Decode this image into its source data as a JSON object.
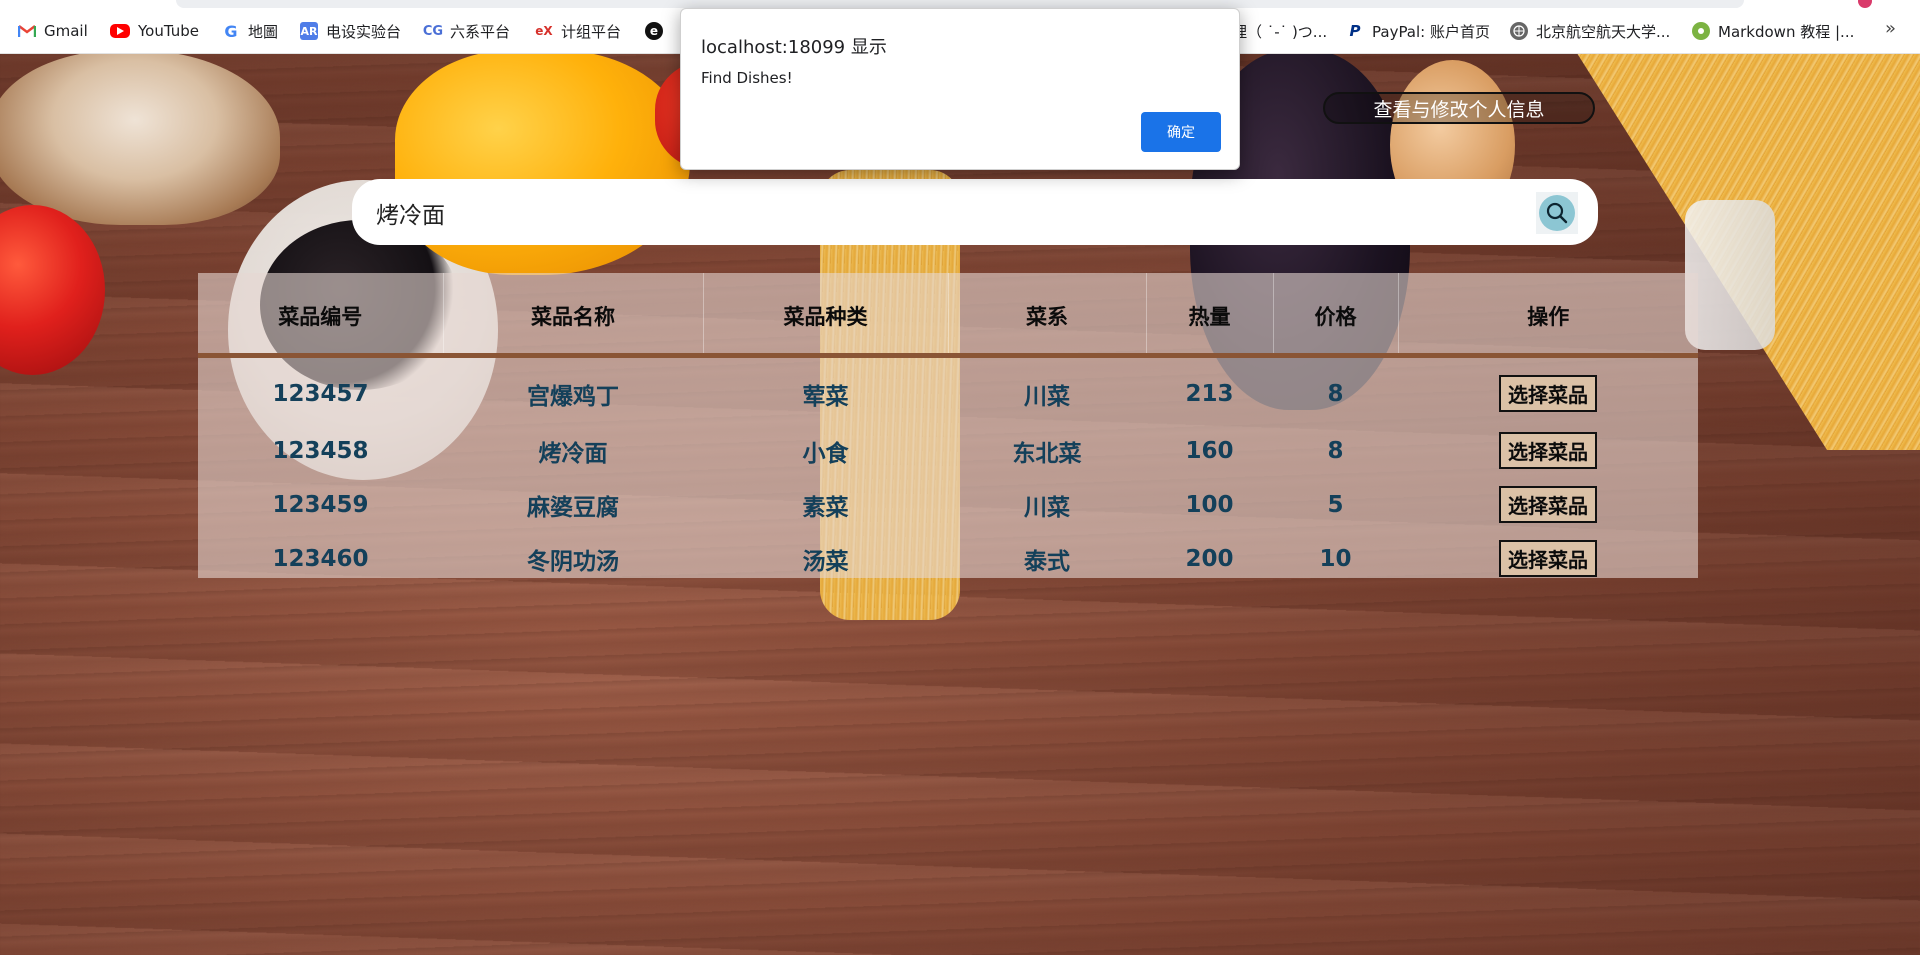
{
  "bookmarks": [
    {
      "label": "Gmail",
      "icon": "gmail-icon",
      "color": "#ea4335"
    },
    {
      "label": "YouTube",
      "icon": "youtube-icon",
      "color": "#ff0000"
    },
    {
      "label": "地圖",
      "icon": "google-icon",
      "color": "#4285f4"
    },
    {
      "label": "电设实验台",
      "icon": "lab-icon",
      "color": "#4f7de8"
    },
    {
      "label": "六系平台",
      "icon": "platform-icon",
      "color": "#4a6fd6"
    },
    {
      "label": "计组平台",
      "icon": "edx-icon",
      "color": "#d6312b"
    },
    {
      "label": "",
      "icon": "circle-e-icon",
      "color": "#111111"
    },
    {
      "label": "理（ ˙-˙ )つ...",
      "icon": "",
      "color": ""
    },
    {
      "label": "PayPal: 账户首页",
      "icon": "paypal-icon",
      "color": "#003087"
    },
    {
      "label": "北京航空航天大学...",
      "icon": "globe-icon",
      "color": "#555555"
    },
    {
      "label": "Markdown 教程 |...",
      "icon": "markdown-icon",
      "color": "#7cb342"
    }
  ],
  "more_bookmarks": "»",
  "alert": {
    "title": "localhost:18099 显示",
    "message": "Find Dishes!",
    "ok_label": "确定"
  },
  "profile_button": "查看与修改个人信息",
  "search": {
    "value": "烤冷面",
    "icon": "search-icon"
  },
  "table": {
    "headers": [
      "菜品编号",
      "菜品名称",
      "菜品种类",
      "菜系",
      "热量",
      "价格",
      "操作"
    ],
    "rows": [
      {
        "id": "123457",
        "name": "宫爆鸡丁",
        "category": "荤菜",
        "cuisine": "川菜",
        "calories": "213",
        "price": "8",
        "action": "选择菜品"
      },
      {
        "id": "123458",
        "name": "烤冷面",
        "category": "小食",
        "cuisine": "东北菜",
        "calories": "160",
        "price": "8",
        "action": "选择菜品"
      },
      {
        "id": "123459",
        "name": "麻婆豆腐",
        "category": "素菜",
        "cuisine": "川菜",
        "calories": "100",
        "price": "5",
        "action": "选择菜品"
      },
      {
        "id": "123460",
        "name": "冬阴功汤",
        "category": "汤菜",
        "cuisine": "泰式",
        "calories": "200",
        "price": "10",
        "action": "选择菜品"
      }
    ]
  },
  "colors": {
    "accent": "#1a73e8",
    "table_text": "#14405a",
    "table_header_rule": "#8a5535",
    "search_button": "#8cc6d3"
  }
}
